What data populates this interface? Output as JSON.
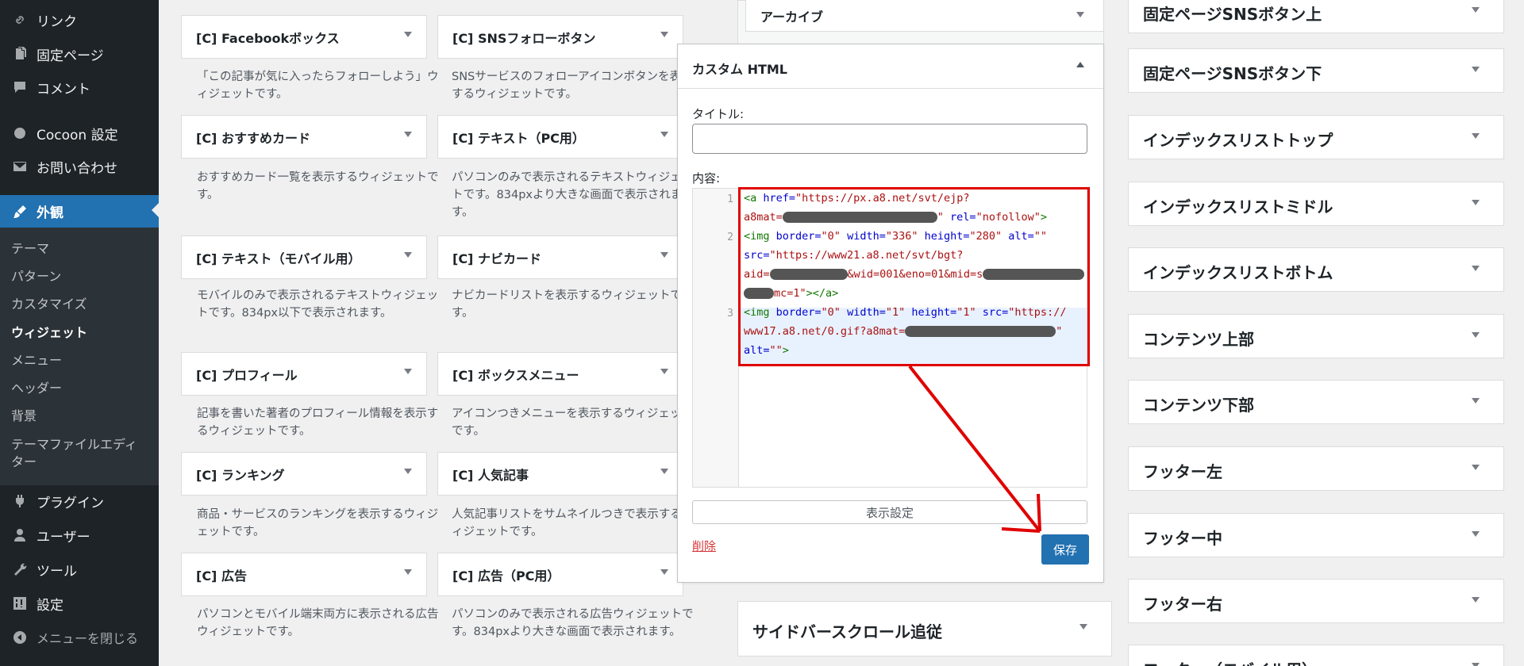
{
  "sidebar": {
    "menu": [
      {
        "label": "リンク",
        "icon": "link-icon"
      },
      {
        "label": "固定ページ",
        "icon": "page-icon"
      },
      {
        "label": "コメント",
        "icon": "comment-icon"
      },
      {
        "label": "Cocoon 設定",
        "icon": "circle-icon"
      },
      {
        "label": "お問い合わせ",
        "icon": "mail-icon"
      },
      {
        "label": "外観",
        "icon": "brush-icon"
      },
      {
        "label": "プラグイン",
        "icon": "plugin-icon"
      },
      {
        "label": "ユーザー",
        "icon": "user-icon"
      },
      {
        "label": "ツール",
        "icon": "wrench-icon"
      },
      {
        "label": "設定",
        "icon": "settings-icon"
      },
      {
        "label": "メニューを閉じる",
        "icon": "collapse-icon"
      }
    ],
    "submenu": [
      "テーマ",
      "パターン",
      "カスタマイズ",
      "ウィジェット",
      "メニュー",
      "ヘッダー",
      "背景",
      "テーマファイルエディター"
    ]
  },
  "widgets": [
    {
      "title": "[C] Facebookボックス",
      "desc": "「この記事が気に入ったらフォローしよう」ウィジェットです。"
    },
    {
      "title": "[C] SNSフォローボタン",
      "desc": "SNSサービスのフォローアイコンボタンを表示するウィジェットです。"
    },
    {
      "title": "[C] おすすめカード",
      "desc": "おすすめカード一覧を表示するウィジェットです。"
    },
    {
      "title": "[C] テキスト（PC用）",
      "desc": "パソコンのみで表示されるテキストウィジェットです。834pxより大きな画面で表示されます。"
    },
    {
      "title": "[C] テキスト（モバイル用）",
      "desc": "モバイルのみで表示されるテキストウィジェットです。834px以下で表示されます。"
    },
    {
      "title": "[C] ナビカード",
      "desc": "ナビカードリストを表示するウィジェットです。"
    },
    {
      "title": "[C] プロフィール",
      "desc": "記事を書いた著者のプロフィール情報を表示するウィジェットです。"
    },
    {
      "title": "[C] ボックスメニュー",
      "desc": "アイコンつきメニューを表示するウィジェットです。"
    },
    {
      "title": "[C] ランキング",
      "desc": "商品・サービスのランキングを表示するウィジェットです。"
    },
    {
      "title": "[C] 人気記事",
      "desc": "人気記事リストをサムネイルつきで表示するウィジェットです。"
    },
    {
      "title": "[C] 広告",
      "desc": "パソコンとモバイル端末両方に表示される広告ウィジェットです。"
    },
    {
      "title": "[C] 広告（PC用）",
      "desc": "パソコンのみで表示される広告ウィジェットです。834pxより大きな画面で表示されます。"
    }
  ],
  "middle": {
    "archive_title": "アーカイブ",
    "sidebar_scroll_title": "サイドバースクロール追従"
  },
  "custom_html": {
    "title": "カスタム HTML",
    "title_label": "タイトル:",
    "title_value": "",
    "content_label": "内容:",
    "line_numbers": [
      "1",
      "2",
      "3"
    ],
    "display_settings": "表示設定",
    "delete": "削除",
    "save": "保存",
    "code": {
      "l1a_tag": "<a ",
      "l1a_attr": "href=",
      "l1a_val": "\"https://px.a8.net/svt/ejp?",
      "l1b_val1": "a8mat=",
      "l1b_val2": "\"",
      "l1b_attr": " rel=",
      "l1b_val3": "\"nofollow\"",
      "l1b_tag": ">",
      "l2a_tag": "<img ",
      "l2a_attr1": "border=",
      "l2a_val1": "\"0\"",
      "l2a_attr2": " width=",
      "l2a_val2": "\"336\"",
      "l2a_attr3": " height=",
      "l2a_val3": "\"280\"",
      "l2a_attr4": " alt=",
      "l2a_val4": "\"\"",
      "l2b_attr": "src=",
      "l2b_val": "\"https://www21.a8.net/svt/bgt?",
      "l2c_val1": "aid=",
      "l2c_val2": "&wid=001&eno=01&mid=s",
      "l2d_val": "mc=1\"",
      "l2d_tag": "></a>",
      "l3a_tag": "<img ",
      "l3a_attr1": "border=",
      "l3a_val1": "\"0\"",
      "l3a_attr2": " width=",
      "l3a_val2": "\"1\"",
      "l3a_attr3": " height=",
      "l3a_val3": "\"1\"",
      "l3a_attr4": " src=",
      "l3a_val4": "\"https://",
      "l3b_val1": "www17.a8.net/0.gif?a8mat=",
      "l3b_val2": "\"",
      "l3c_attr": "alt=",
      "l3c_val": "\"\"",
      "l3c_tag": ">"
    }
  },
  "right_areas": [
    "固定ページSNSボタン上",
    "固定ページSNSボタン下",
    "インデックスリストトップ",
    "インデックスリストミドル",
    "インデックスリストボトム",
    "コンテンツ上部",
    "コンテンツ下部",
    "フッター左",
    "フッター中",
    "フッター右",
    "フッター（モバイル用）"
  ],
  "colors": {
    "admin_bar": "#1d2327",
    "accent": "#2271b1",
    "highlight": "#e00000",
    "delete": "#d63638"
  }
}
